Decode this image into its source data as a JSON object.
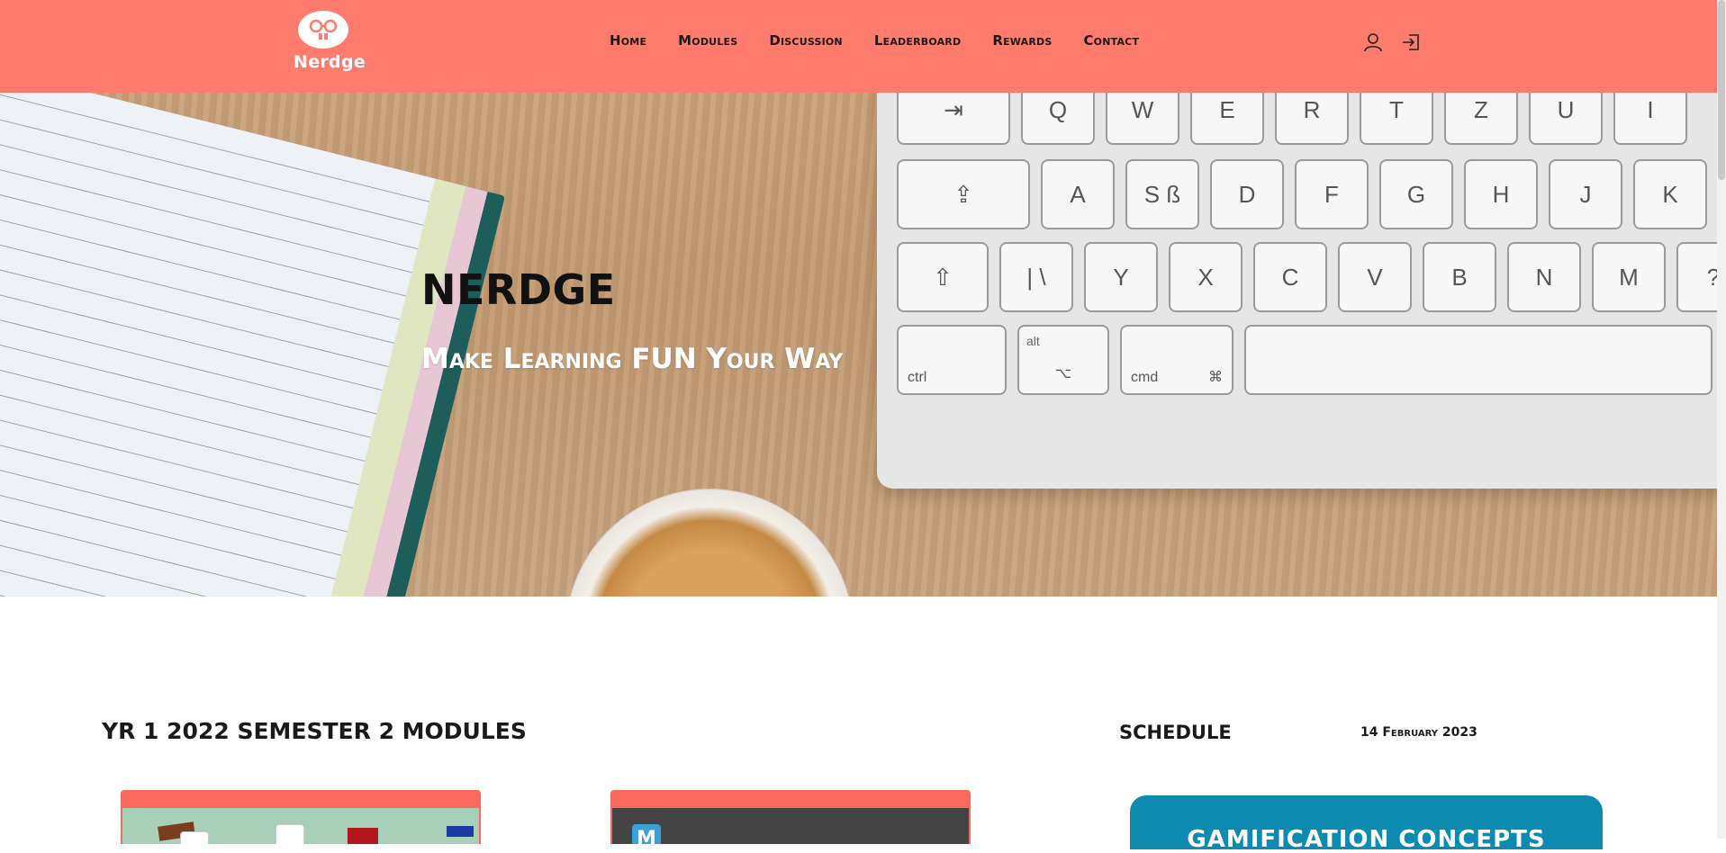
{
  "header": {
    "logo_text": "Nerdge",
    "nav": [
      "Home",
      "Modules",
      "Discussion",
      "Leaderboard",
      "Rewards",
      "Contact"
    ],
    "icons": [
      "user-icon",
      "login-icon"
    ],
    "background": "#ff7b6d"
  },
  "hero": {
    "title": "NERDGE",
    "subtitle": "Make Learning FUN Your Way",
    "keyboard": {
      "row1": [
        "Q",
        "W",
        "E",
        "R",
        "T",
        "Z",
        "U",
        "I"
      ],
      "row2": [
        "A",
        "S ß",
        "D",
        "F",
        "G",
        "H",
        "J",
        "K"
      ],
      "row3": [
        "| \\",
        "Y",
        "X",
        "C",
        "V",
        "B",
        "N",
        "M",
        "?"
      ],
      "ctrl": "ctrl",
      "alt": "alt",
      "cmd": "cmd"
    }
  },
  "modules": {
    "title": "YR 1 2022 SEMESTER 2 MODULES",
    "card2_badge": "M"
  },
  "schedule": {
    "title": "SCHEDULE",
    "date": "14 February 2023",
    "card_title": "GAMIFICATION CONCEPTS"
  },
  "colors": {
    "accent": "#ff7b6d",
    "card_header": "#fa6a5c",
    "schedule_card": "#0d8ab0"
  }
}
